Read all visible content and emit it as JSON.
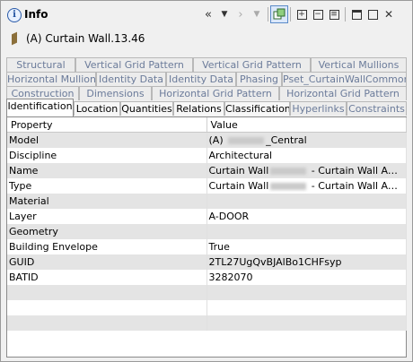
{
  "header": {
    "title": "Info",
    "object_name": "(A) Curtain Wall.13.46"
  },
  "toolbar": {
    "back_icon": "double-chevron-left-icon",
    "back_menu_icon": "dropdown-arrow-icon",
    "forward_icon": "chevron-right-icon",
    "forward_menu_icon": "dropdown-arrow-icon",
    "link_icon": "link-selection-icon",
    "expand_icon": "expand-all-icon",
    "collapse_icon": "collapse-all-icon",
    "list_icon": "list-icon",
    "restore_icon": "restore-icon",
    "maximize_icon": "maximize-icon",
    "close_icon": "close-icon"
  },
  "tabs": {
    "row1": [
      "Structural",
      "Vertical Grid Pattern",
      "Vertical Grid Pattern",
      "Vertical Mullions"
    ],
    "row2": [
      "Horizontal Mullions",
      "Identity Data",
      "Identity Data",
      "Phasing",
      "Pset_CurtainWallCommon"
    ],
    "row3": [
      "Construction",
      "Dimensions",
      "Horizontal Grid Pattern",
      "Horizontal Grid Pattern"
    ],
    "row4": [
      "Identification",
      "Location",
      "Quantities",
      "Relations",
      "Classification",
      "Hyperlinks",
      "Constraints"
    ]
  },
  "table": {
    "headers": [
      "Property",
      "Value"
    ],
    "rows": [
      {
        "property": "Model",
        "value_pre": "(A) ",
        "value_post": "_Central"
      },
      {
        "property": "Discipline",
        "value_pre": "Architectural",
        "value_post": ""
      },
      {
        "property": "Name",
        "value_pre": "Curtain Wall",
        "value_post": " - Curtain Wall Admin..."
      },
      {
        "property": "Type",
        "value_pre": "Curtain Wall",
        "value_post": " - Curtain Wall Admin"
      },
      {
        "property": "Material",
        "value_pre": "",
        "value_post": ""
      },
      {
        "property": "Layer",
        "value_pre": "A-DOOR",
        "value_post": ""
      },
      {
        "property": "Geometry",
        "value_pre": "",
        "value_post": ""
      },
      {
        "property": "Building Envelope",
        "value_pre": "True",
        "value_post": ""
      },
      {
        "property": "GUID",
        "value_pre": "2TL27UgQvBJAlBo1CHFsyp",
        "value_post": ""
      },
      {
        "property": "BATID",
        "value_pre": "3282070",
        "value_post": ""
      }
    ]
  }
}
